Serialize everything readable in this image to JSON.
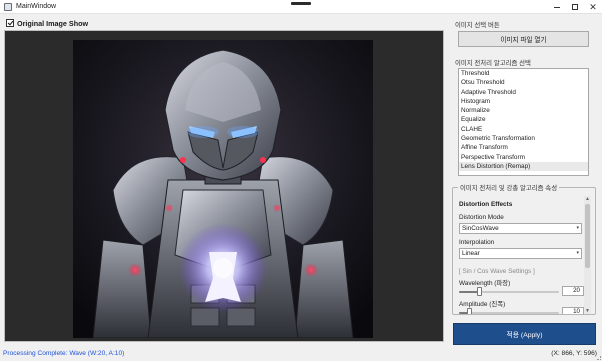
{
  "window": {
    "title": "MainWindow"
  },
  "left": {
    "checkbox_label": "Original Image Show",
    "checkbox_checked": true
  },
  "right": {
    "select_group_label": "이미지 선택 버튼",
    "open_button": "이미지 파일 열기",
    "algo_group_label": "이미지 전처리 알고리즘 선택",
    "algorithms": [
      "Threshold",
      "Otsu Threshold",
      "Adaptive Threshold",
      "Histogram",
      "Normalize",
      "Equalize",
      "CLAHE",
      "Geometric Transformation",
      "Affine Transform",
      "Perspective Transform",
      "Lens Distortion (Remap)"
    ],
    "selected_algorithm": "Lens Distortion (Remap)",
    "props_group_label": "이미지 전처리 및 강총 알고리즘 속성",
    "props": {
      "section_title": "Distortion Effects",
      "mode_label": "Distortion Mode",
      "mode_value": "SinCosWave",
      "interp_label": "Interpolation",
      "interp_value": "Linear",
      "wave_header": "[ Sin / Cos Wave Settings ]",
      "wavelength_label": "Wavelength (파장)",
      "wavelength_value": "20",
      "wavelength_level": 0.2,
      "amplitude_label": "Amplitude (진폭)",
      "amplitude_value": "10",
      "amplitude_level": 0.1
    },
    "apply_button": "적용 (Apply)"
  },
  "status": {
    "message": "Processing Complete: Wave (W:20, A:10)",
    "coords": "(X: 866, Y: 596)"
  },
  "colors": {
    "apply_bg": "#1f4e8c",
    "status_text": "#1f52d6",
    "robot_glow": "#6aa6ff",
    "robot_red": "#ff3050"
  },
  "icons": {
    "app": "app-window-icon",
    "minimize": "minimize-icon",
    "maximize": "maximize-icon",
    "close": "close-icon",
    "check": "checkmark-icon",
    "dropdown": "chevron-down-icon"
  }
}
